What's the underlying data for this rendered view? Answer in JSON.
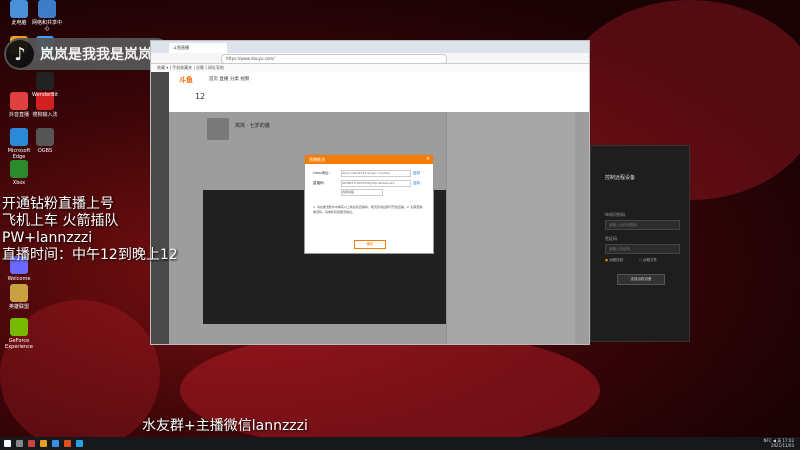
{
  "desktop": {
    "icons": [
      {
        "label": "此电脑",
        "color": "#4a90d9"
      },
      {
        "label": "网络和共享中心",
        "color": "#3d7cc9"
      },
      {
        "label": "Hi",
        "color": "#f0a020"
      },
      {
        "label": "WeGame",
        "color": "#3aa0ff"
      },
      {
        "label": "抖音直播",
        "color": "#e04040"
      },
      {
        "label": "搜狗输入法",
        "color": "#d02020"
      },
      {
        "label": "WonderBit",
        "color": "#222"
      },
      {
        "label": "Microsoft Edge",
        "color": "#2a8ad8"
      },
      {
        "label": "OGBS",
        "color": "#555"
      },
      {
        "label": "Xbox",
        "color": "#2b8a2b"
      },
      {
        "label": "Welcome",
        "color": "#6a6aff"
      },
      {
        "label": "英雄联盟",
        "color": "#c8a040"
      },
      {
        "label": "GeForce Experience",
        "color": "#76b900"
      }
    ]
  },
  "overlay": {
    "tiktok_name": "岚岚是我我是岚岚",
    "line1": "开通钻粉直播上号",
    "line2": "飞机上车 火箭插队",
    "line3": "PW+lannzzzi",
    "line4": "直播时间：中午12到晚上12",
    "bottom_text": "水友群+主播微信lannzzzi"
  },
  "browser": {
    "tab_title": "斗鱼直播",
    "url": "https://www.douyu.com/",
    "bookmarks": "收藏 ▾ | 手机收藏夹 | 谷歌 | 网址导航",
    "logo": "斗鱼",
    "nav_items": [
      "首页",
      "直播",
      "分类",
      "视频"
    ],
    "room_num": "12",
    "streamer": "岚岚 · 七岁的猫",
    "dialog": {
      "title": "直播推流",
      "field1_label": "rtmp地址:",
      "field1_value": "rtmp://sendtc3a.douyu.com/live",
      "field1_btn": "复制",
      "field2_label": "直播码:",
      "field2_value": "3638417rOXTXVrbyhhp?wsSecret=",
      "field2_btn": "复制",
      "select_value": "选择线路",
      "note": "1. 请在推流软件中填写以上地址和直播码，推流完成后即可开始直播。2. 如需更换推流码，请重新获取推流地址。",
      "ok": "确定"
    }
  },
  "remote_panel": {
    "title": "控制远程设备",
    "id_label": "伙伴识别码",
    "id_placeholder": "请输入伙伴识别码",
    "pwd_label": "验证码",
    "pwd_placeholder": "请输入验证码",
    "opt1": "远程控制",
    "opt2": "远程文件",
    "connect": "连接远程设备"
  },
  "taskbar": {
    "time": "17:02",
    "date": "2021/11/03",
    "lang": "英",
    "tray_icons": "NFC ◀"
  }
}
